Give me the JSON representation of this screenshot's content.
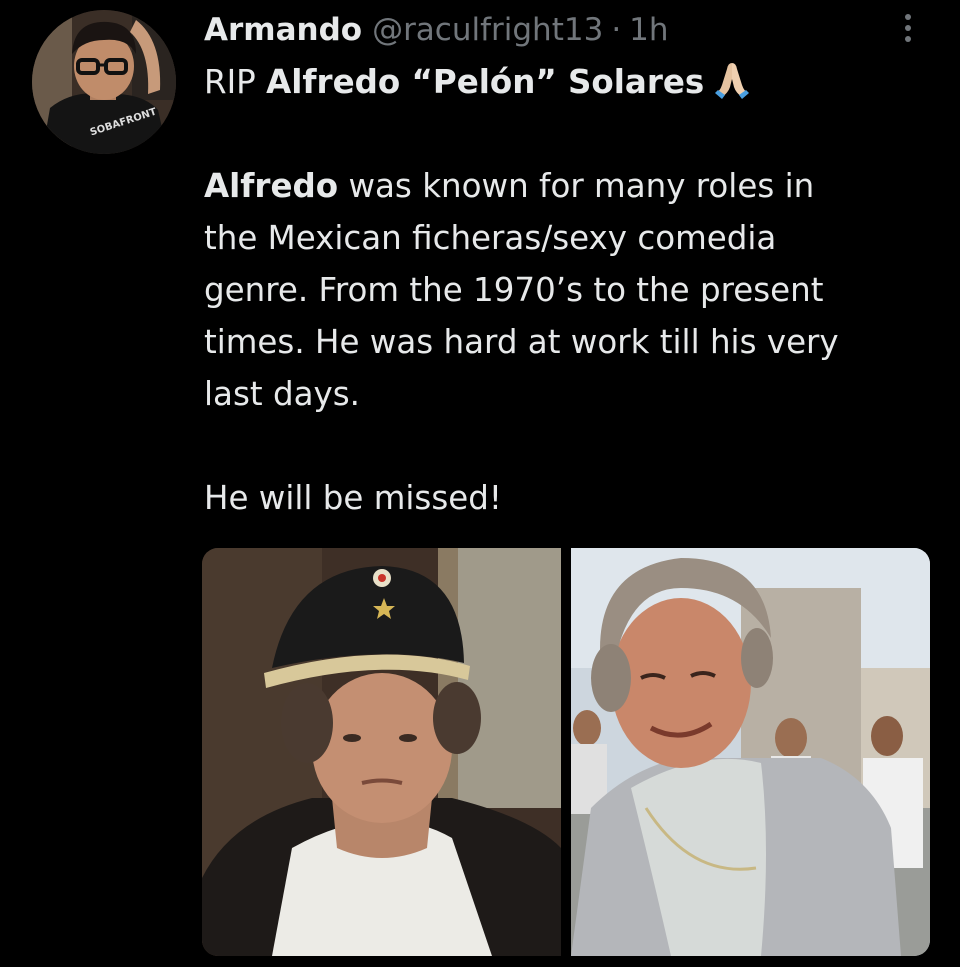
{
  "tweet": {
    "author_name": "Armando",
    "handle": "@raculfright13",
    "separator": "·",
    "time": "1h",
    "avatar_shirt_text": "SOBAFRONT",
    "icons": {
      "more": "more-options-icon",
      "emoji": "folded-hands-emoji"
    },
    "text": {
      "line1_a": "RIP ",
      "line1_b": "Alfredo “Pelón” Solares",
      "line2_a": "Alfredo",
      "line2_b": " was known for many roles in",
      "line3": "the Mexican ficheras/sexy comedia",
      "line4": "genre. From the 1970’s to the present",
      "line5": "times. He was hard at work till his very",
      "line6": "last days.",
      "line7": "He will be missed!"
    }
  },
  "colors": {
    "background": "#000000",
    "text_primary": "#e7e9ea",
    "text_secondary": "#71767b"
  }
}
